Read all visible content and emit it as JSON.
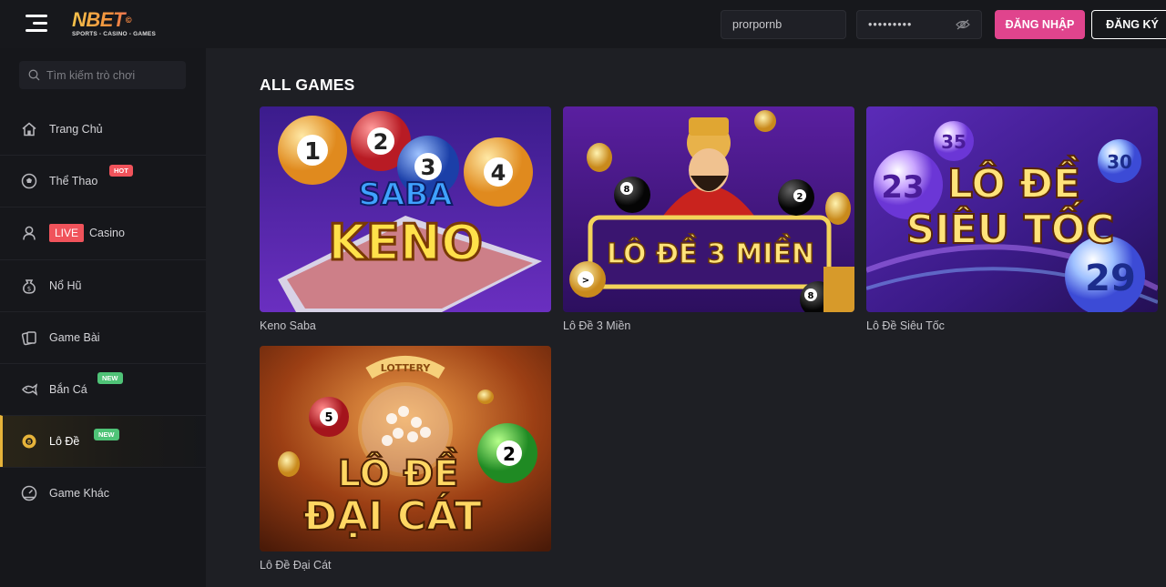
{
  "header": {
    "logo_text": "NBET",
    "logo_reg": "©",
    "logo_tagline": "SPORTS - CASINO - GAMES",
    "username_value": "prorpornb",
    "password_mask": "•••••••••",
    "login_label": "ĐĂNG NHẬP",
    "register_label": "ĐĂNG KÝ"
  },
  "sidebar": {
    "search_placeholder": "Tìm kiếm trò chơi",
    "items": [
      {
        "label": "Trang Chủ",
        "icon": "home-icon"
      },
      {
        "label": "Thể Thao",
        "icon": "soccer-ball-icon",
        "badge": "HOT"
      },
      {
        "label": "Casino",
        "icon": "dealer-icon",
        "live": "LIVE"
      },
      {
        "label": "Nổ Hũ",
        "icon": "money-bag-icon"
      },
      {
        "label": "Game Bài",
        "icon": "cards-icon"
      },
      {
        "label": "Bắn Cá",
        "icon": "fish-icon",
        "badge": "NEW"
      },
      {
        "label": "Lô Đề",
        "icon": "lottery-ball-icon",
        "badge": "NEW",
        "active": true
      },
      {
        "label": "Game Khác",
        "icon": "gauge-icon"
      }
    ]
  },
  "main": {
    "title": "ALL GAMES",
    "games": [
      {
        "label": "Keno Saba",
        "art_top": "SABA",
        "art_bottom": "KENO"
      },
      {
        "label": "Lô Đề 3 Miền",
        "art_text": "LÔ ĐỀ 3 MIỀN"
      },
      {
        "label": "Lô Đề Siêu Tốc",
        "art_top": "LÔ ĐỀ",
        "art_bottom": "SIÊU TỐC"
      },
      {
        "label": "Lô Đề Đại Cát",
        "art_top": "LÔ ĐỀ",
        "art_bottom": "ĐẠI CÁT",
        "art_ring": "LOTTERY"
      }
    ]
  },
  "colors": {
    "accent_pink": "#e0448d",
    "active_gold": "#e6b33a",
    "hot_red": "#f0535b",
    "new_green": "#4fc377"
  }
}
